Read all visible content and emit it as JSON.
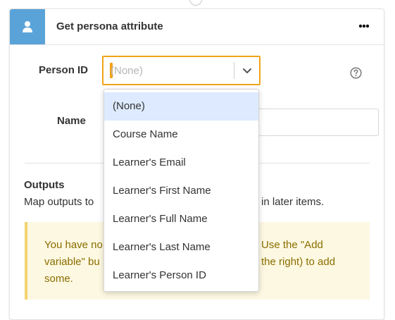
{
  "card": {
    "title": "Get persona attribute",
    "more_label": "•••",
    "header_color": "#5aa3d9"
  },
  "fields": {
    "person_id_label": "Person ID",
    "person_id_value": "(None)",
    "name_label": "Name",
    "name_value": ""
  },
  "outputs": {
    "title": "Outputs",
    "description_left": "Map outputs to",
    "description_right": "in later items."
  },
  "warning": {
    "line1_left": "You have no",
    "line1_right": "Use the \"Add",
    "line2_left": "variable\" bu",
    "line2_right": "the right) to add",
    "line3": "some."
  },
  "dropdown": {
    "options": [
      {
        "label": "(None)",
        "selected": true
      },
      {
        "label": "Course Name",
        "selected": false
      },
      {
        "label": "Learner's Email",
        "selected": false
      },
      {
        "label": "Learner's First Name",
        "selected": false
      },
      {
        "label": "Learner's Full Name",
        "selected": false
      },
      {
        "label": "Learner's Last Name",
        "selected": false
      },
      {
        "label": "Learner's Person ID",
        "selected": false
      }
    ]
  },
  "colors": {
    "focus_border": "#f0a419",
    "selected_option": "#ddeaff",
    "warning_bg": "#fdf8e1",
    "warning_text": "#8a6d00"
  }
}
